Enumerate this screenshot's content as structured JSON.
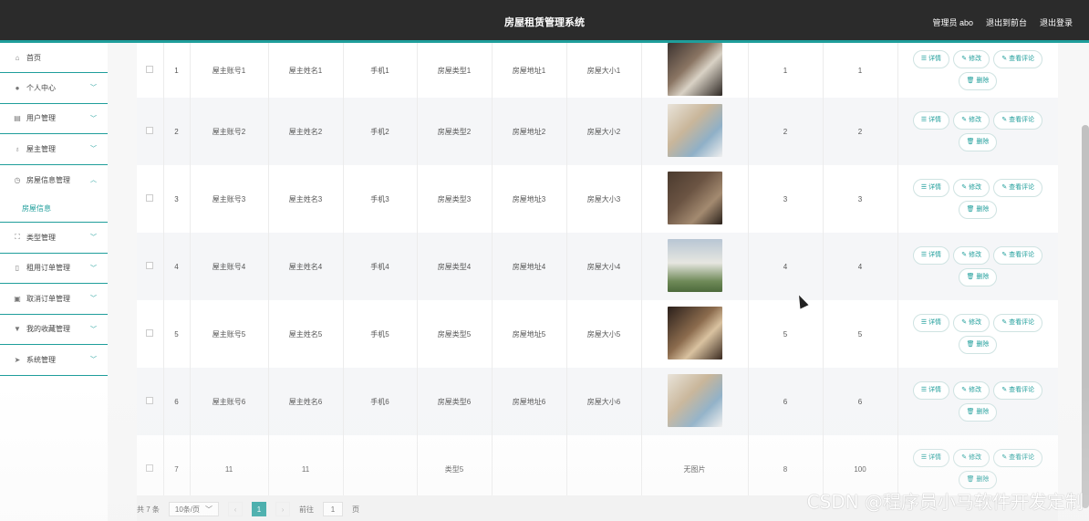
{
  "header": {
    "title": "房屋租赁管理系统",
    "user": "管理员 abo",
    "back_front": "退出到前台",
    "logout": "退出登录"
  },
  "sidebar": {
    "items": [
      {
        "label": "首页",
        "icon": "home-icon",
        "glyph": "⌂"
      },
      {
        "label": "个人中心",
        "icon": "user-icon",
        "glyph": "👤"
      },
      {
        "label": "用户管理",
        "icon": "users-icon",
        "glyph": "▤"
      },
      {
        "label": "屋主管理",
        "icon": "mic-icon",
        "glyph": "♁"
      },
      {
        "label": "房屋信息管理",
        "icon": "clock-icon",
        "glyph": "◷"
      },
      {
        "label": "类型管理",
        "icon": "expand-icon",
        "glyph": "⛶"
      },
      {
        "label": "租用订单管理",
        "icon": "doc-icon",
        "glyph": "▯"
      },
      {
        "label": "取消订单管理",
        "icon": "briefcase-icon",
        "glyph": "▣"
      },
      {
        "label": "我的收藏管理",
        "icon": "bookmark-icon",
        "glyph": "▼"
      },
      {
        "label": "系统管理",
        "icon": "send-icon",
        "glyph": "➤"
      }
    ],
    "sub_item": "房屋信息"
  },
  "table": {
    "rows": [
      {
        "no": "1",
        "account": "屋主账号1",
        "name": "屋主姓名1",
        "phone": "手机1",
        "type": "房屋类型1",
        "address": "房屋地址1",
        "size": "房屋大小1",
        "image": "photo",
        "a": "1",
        "b": "1"
      },
      {
        "no": "2",
        "account": "屋主账号2",
        "name": "屋主姓名2",
        "phone": "手机2",
        "type": "房屋类型2",
        "address": "房屋地址2",
        "size": "房屋大小2",
        "image": "photo",
        "a": "2",
        "b": "2"
      },
      {
        "no": "3",
        "account": "屋主账号3",
        "name": "屋主姓名3",
        "phone": "手机3",
        "type": "房屋类型3",
        "address": "房屋地址3",
        "size": "房屋大小3",
        "image": "photo",
        "a": "3",
        "b": "3"
      },
      {
        "no": "4",
        "account": "屋主账号4",
        "name": "屋主姓名4",
        "phone": "手机4",
        "type": "房屋类型4",
        "address": "房屋地址4",
        "size": "房屋大小4",
        "image": "photo",
        "a": "4",
        "b": "4"
      },
      {
        "no": "5",
        "account": "屋主账号5",
        "name": "屋主姓名5",
        "phone": "手机5",
        "type": "房屋类型5",
        "address": "房屋地址5",
        "size": "房屋大小5",
        "image": "photo",
        "a": "5",
        "b": "5"
      },
      {
        "no": "6",
        "account": "屋主账号6",
        "name": "屋主姓名6",
        "phone": "手机6",
        "type": "房屋类型6",
        "address": "房屋地址6",
        "size": "房屋大小6",
        "image": "photo",
        "a": "6",
        "b": "6"
      },
      {
        "no": "7",
        "account": "11",
        "name": "11",
        "phone": "",
        "type": "类型5",
        "address": "",
        "size": "",
        "image": "无图片",
        "a": "8",
        "b": "100"
      }
    ],
    "actions": {
      "detail": "详情",
      "edit": "修改",
      "comments": "查看评论",
      "delete": "删除"
    }
  },
  "pager": {
    "total": "共 7 条",
    "page_size": "10条/页",
    "current": "1",
    "goto_label": "前往",
    "goto_value": "1",
    "page_suffix": "页"
  },
  "watermark": "CSDN @程序员小马软件开发定制",
  "colors": {
    "accent": "#1f9e9b",
    "header_bg": "#2b2b2b"
  }
}
